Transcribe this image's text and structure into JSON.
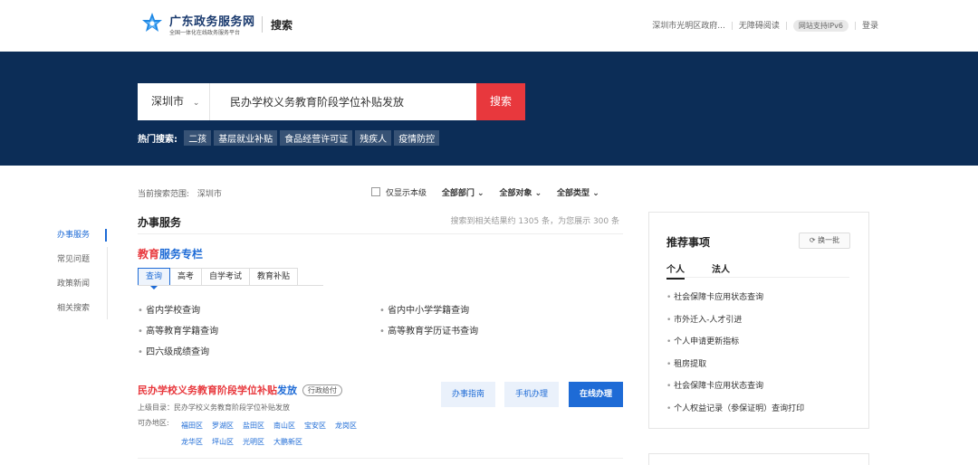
{
  "header": {
    "brand_title": "广东政务服务网",
    "brand_subtitle": "全国一体化在线政务服务平台",
    "page_name": "搜索",
    "region": "深圳市光明区政府...",
    "accessibility": "无障碍阅读",
    "ipv6": "网站支持IPv6",
    "login": "登录"
  },
  "search": {
    "city": "深圳市",
    "query": "民办学校义务教育阶段学位补贴发放",
    "button": "搜索",
    "hot_label": "热门搜索:",
    "hot_tags": [
      "二孩",
      "基层就业补贴",
      "食品经营许可证",
      "残疾人",
      "疫情防控"
    ]
  },
  "filters": {
    "scope_label": "当前搜索范围:",
    "scope_value": "深圳市",
    "level_only": "仅显示本级",
    "dept": "全部部门",
    "target": "全部对象",
    "type": "全部类型"
  },
  "nav": {
    "items": [
      {
        "label": "办事服务"
      },
      {
        "label": "常见问题"
      },
      {
        "label": "政策新闻"
      },
      {
        "label": "相关搜索"
      }
    ]
  },
  "main": {
    "section_title": "办事服务",
    "result_count": "搜索到相关结果约 1305 条，为您展示 300 条",
    "edu_title_red": "教育",
    "edu_title_blue": "服务专栏",
    "tabs": [
      {
        "label": "查询"
      },
      {
        "label": "高考"
      },
      {
        "label": "自学考试"
      },
      {
        "label": "教育补贴"
      }
    ],
    "links": [
      "省内学校查询",
      "省内中小学学籍查询",
      "高等教育学籍查询",
      "高等教育学历证书查询",
      "四六级成绩查询"
    ],
    "item": {
      "title_red": "民办学校义务教育阶段学位补贴",
      "title_blue": "发放",
      "tag": "行政给付",
      "catalog": "上级目录：民办学校义务教育阶段学位补贴发放",
      "area_label": "可办地区:",
      "areas": [
        "福田区",
        "罗湖区",
        "盐田区",
        "南山区",
        "宝安区",
        "龙岗区",
        "龙华区",
        "坪山区",
        "光明区",
        "大鹏新区"
      ],
      "btn_guide": "办事指南",
      "btn_mobile": "手机办理",
      "btn_online": "在线办理"
    }
  },
  "panel": {
    "title": "推荐事项",
    "refresh": "换一批",
    "tabs": [
      {
        "label": "个人"
      },
      {
        "label": "法人"
      }
    ],
    "items": [
      "社会保障卡应用状态查询",
      "市外迁入-人才引进",
      "个人申请更新指标",
      "租房提取",
      "社会保障卡应用状态查询",
      "个人权益记录（参保证明）查询打印"
    ]
  },
  "colors": {
    "hero_bg": "#0c2d57",
    "accent_blue": "#1e6bd6",
    "accent_red": "#e8383d"
  }
}
